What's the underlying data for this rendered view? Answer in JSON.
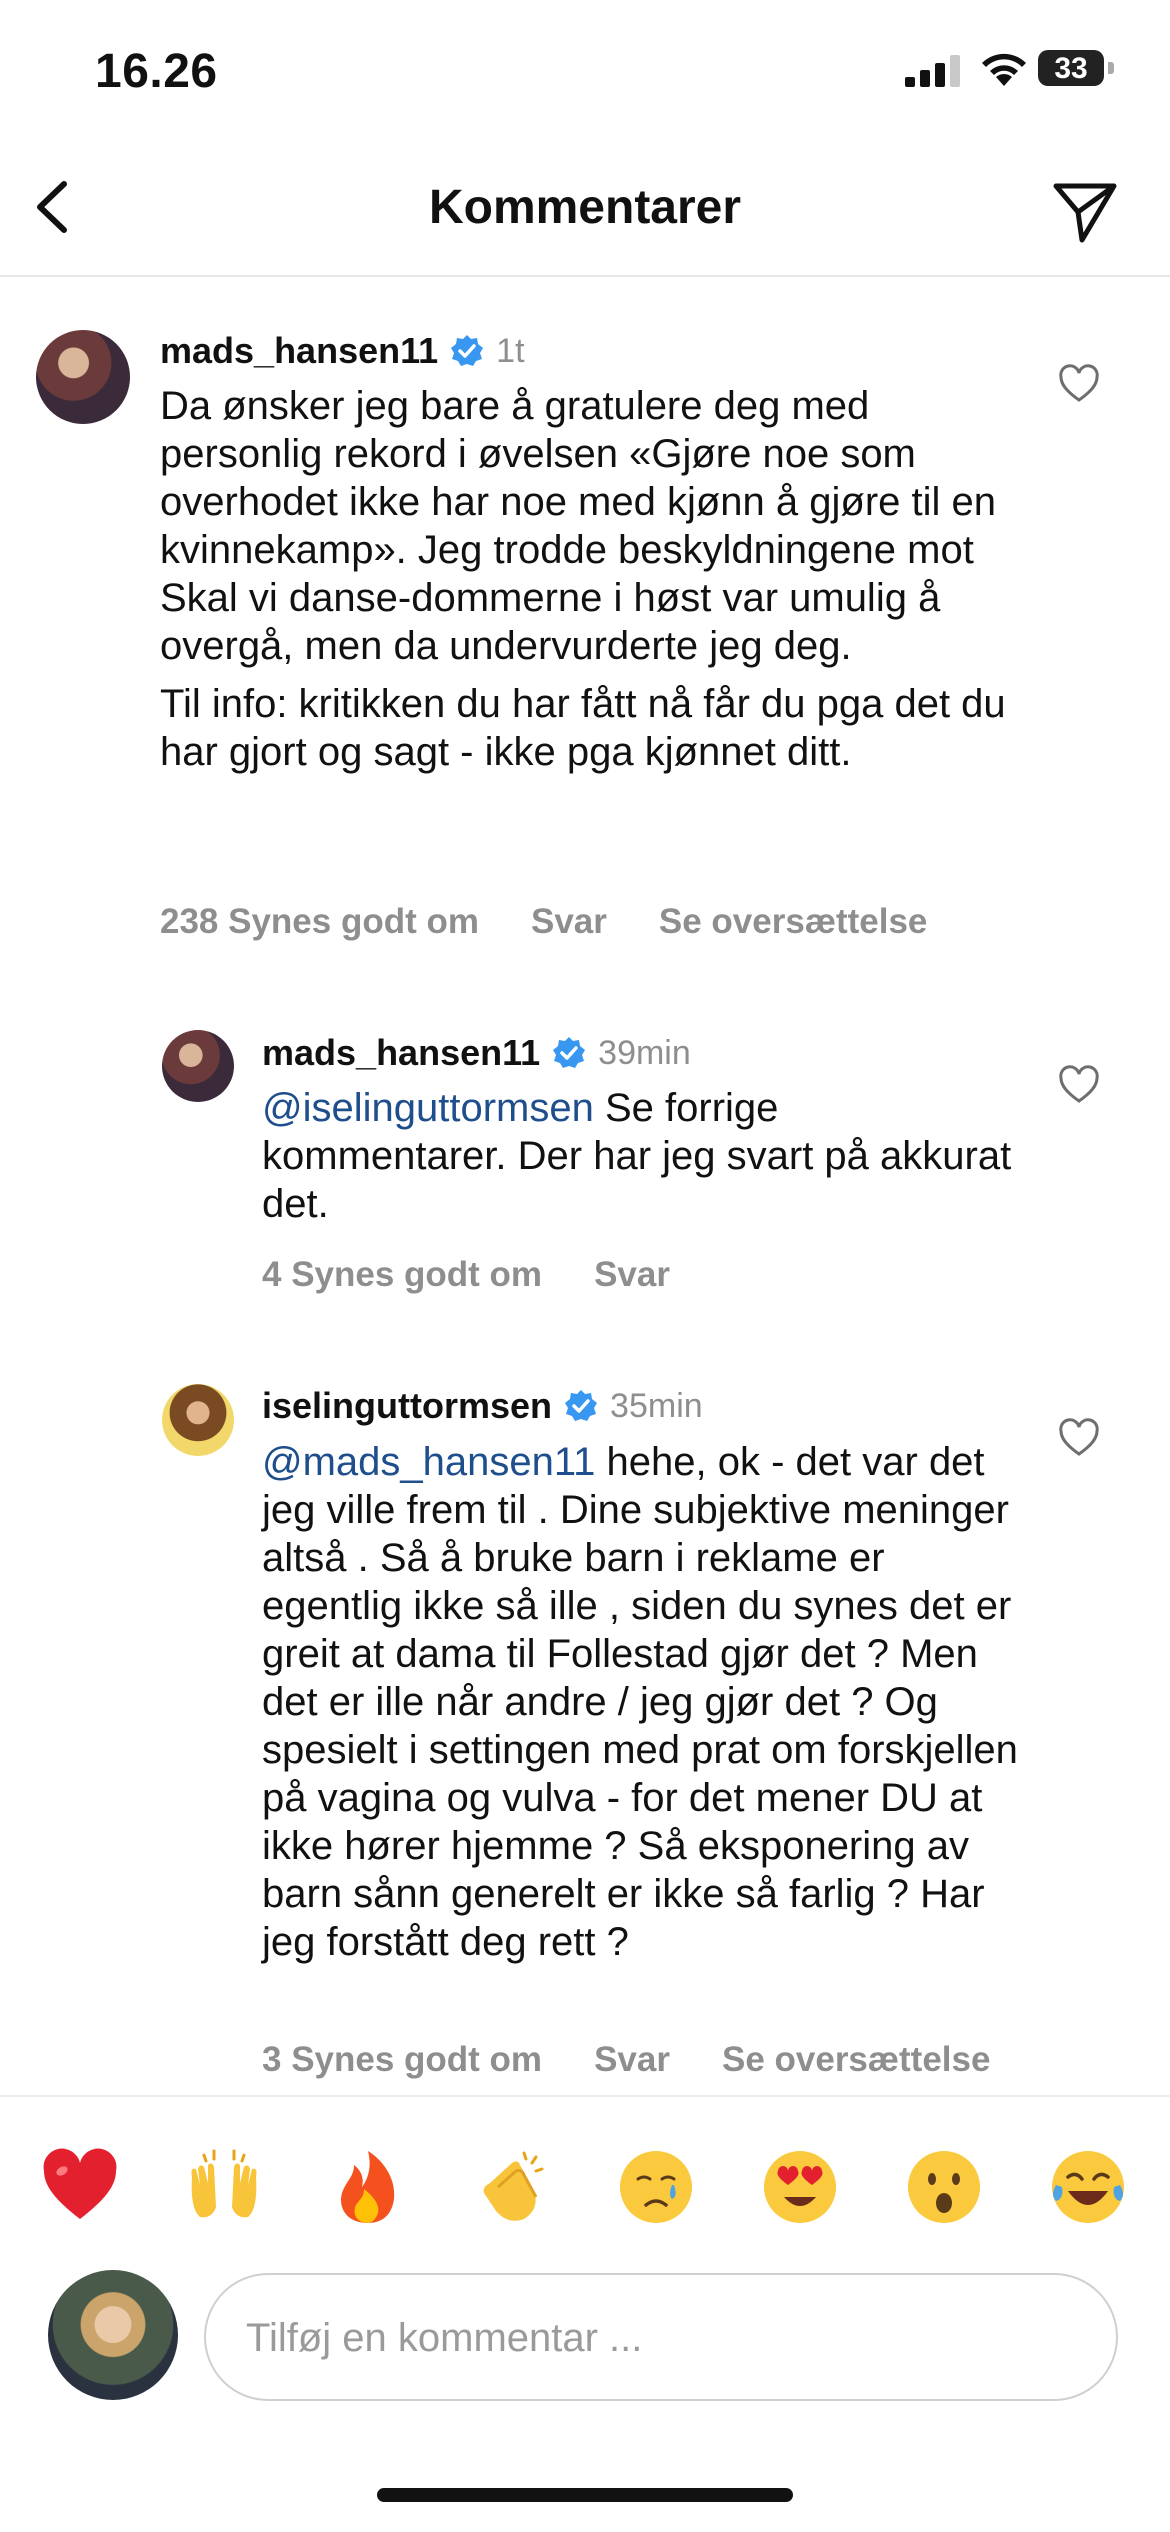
{
  "status_bar": {
    "time": "16.26",
    "battery": "33"
  },
  "header": {
    "title": "Kommentarer"
  },
  "comments": [
    {
      "username": "mads_hansen11",
      "verified": true,
      "ago": "1t",
      "paragraph1": "Da ønsker jeg bare å gratulere deg med personlig rekord i øvelsen «Gjøre noe som overhodet ikke har noe med kjønn å gjøre til en kvinnekamp». Jeg trodde beskyldningene mot Skal vi danse-dommerne i høst var umulig å overgå, men da undervurderte jeg deg.",
      "paragraph2": "Til info: kritikken du har fått nå får du pga det du har gjort og sagt - ikke pga kjønnet ditt.",
      "likes": "238 Synes godt om",
      "reply": "Svar",
      "translate": "Se oversættelse"
    },
    {
      "username": "mads_hansen11",
      "verified": true,
      "ago": "39min",
      "mention": "@iselinguttormsen",
      "text": " Se forrige kommentarer. Der har jeg svart på akkurat det.",
      "likes": "4 Synes godt om",
      "reply": "Svar"
    },
    {
      "username": "iselinguttormsen",
      "verified": true,
      "ago": "35min",
      "mention": "@mads_hansen11",
      "text": " hehe, ok - det var det jeg ville frem til . Dine subjektive meninger altså . Så å bruke barn i reklame er egentlig ikke så ille , siden du synes det er greit at dama til Follestad  gjør det ? Men det er ille når andre / jeg gjør det ? Og spesielt i settingen med prat om forskjellen på vagina og vulva - for det mener DU at ikke hører hjemme ? Så eksponering av barn sånn generelt er ikke så farlig ? Har jeg forstått deg rett ?",
      "likes": "3 Synes godt om",
      "reply": "Svar",
      "translate": "Se oversættelse"
    }
  ],
  "reactions": [
    "❤️",
    "🙌",
    "🔥",
    "👏",
    "😢",
    "😍",
    "😮",
    "😂"
  ],
  "composer": {
    "placeholder": "Tilføj en kommentar ..."
  },
  "colors": {
    "mention": "#1f4e8c",
    "verified": "#3897f0",
    "muted": "#8e8e8e"
  }
}
